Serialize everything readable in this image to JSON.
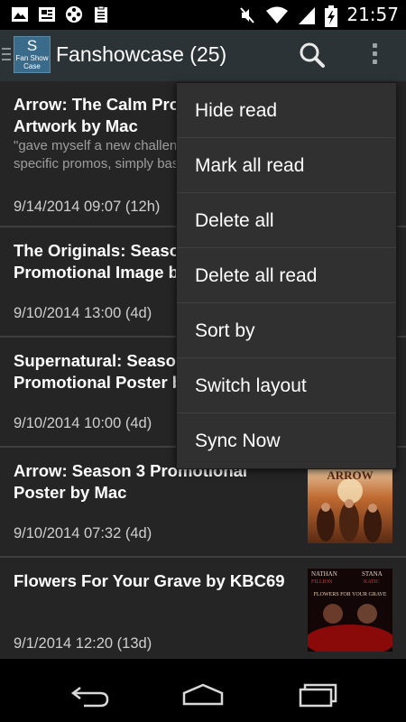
{
  "status_bar": {
    "time": "21:57",
    "icons": [
      "image-icon",
      "news-icon",
      "film-reel-icon",
      "clipboard-icon",
      "mute-icon",
      "wifi-icon",
      "signal-icon",
      "battery-charging-icon"
    ]
  },
  "action_bar": {
    "logo_letter": "S",
    "logo_text_1": "Fan Show",
    "logo_text_2": "Case",
    "title": "Fanshowcase (25)",
    "icons": [
      "menu-icon",
      "search-icon",
      "overflow-icon"
    ]
  },
  "feed": {
    "items": [
      {
        "title": "Arrow: The Calm Promotional Artwork by Mac",
        "snippet": "\"gave myself a new challenge to make episode specific promos, simply based on promotional",
        "date": "9/14/2014 09:07 (12h)"
      },
      {
        "title": "The Originals: Season 2 Promotional Image by Mac",
        "snippet": "",
        "date": "9/10/2014 13:00 (4d)"
      },
      {
        "title": "Supernatural: Season 10 Promotional Poster by Mac",
        "snippet": "",
        "date": "9/10/2014 10:00 (4d)"
      },
      {
        "title": "Arrow: Season 3 Promotional Poster by Mac",
        "snippet": "",
        "date": "9/10/2014 07:32 (4d)"
      },
      {
        "title": "Flowers For Your Grave by KBC69",
        "snippet": "",
        "date": "9/1/2014 12:20 (13d)"
      }
    ],
    "thumb_arrow_text": "ARROW",
    "thumb_flowers_text_1": "NATHAN",
    "thumb_flowers_text_2": "STANA",
    "thumb_flowers_text_3": "FILLION",
    "thumb_flowers_text_4": "KATIC",
    "thumb_flowers_text_5": "FLOWERS FOR YOUR GRAVE"
  },
  "menu": {
    "items": [
      "Hide read",
      "Mark all read",
      "Delete all",
      "Delete all read",
      "Sort by",
      "Switch layout",
      "Sync Now"
    ]
  },
  "nav_bar": {
    "icons": [
      "back-icon",
      "home-icon",
      "recents-icon"
    ]
  },
  "colors": {
    "action_bar_bg": "#2b3337",
    "list_bg": "#252525",
    "menu_bg": "#303030"
  }
}
